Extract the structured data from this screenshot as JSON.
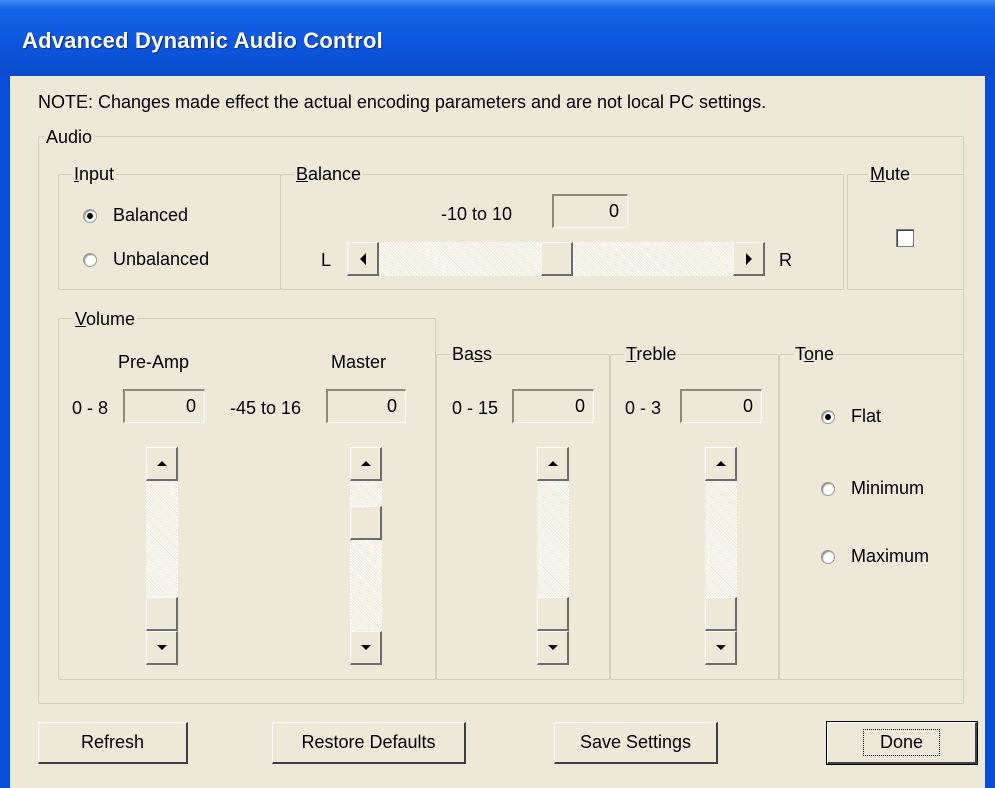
{
  "window": {
    "title": "Advanced Dynamic Audio Control"
  },
  "note": "NOTE: Changes made effect the actual encoding parameters and are not local PC settings.",
  "audio": {
    "label": "Audio",
    "input": {
      "label_accel": "I",
      "label_rest": "nput",
      "options": [
        {
          "label": "Balanced",
          "selected": true
        },
        {
          "label": "Unbalanced",
          "selected": false
        }
      ]
    },
    "balance": {
      "label_accel": "B",
      "label_rest": "alance",
      "range": "-10 to 10",
      "value": "0",
      "left_label": "L",
      "right_label": "R",
      "slider_level": 0.5
    },
    "mute": {
      "label_accel": "M",
      "label_rest": "ute",
      "checked": false
    },
    "volume": {
      "label_accel": "V",
      "label_rest": "olume",
      "preamp": {
        "title": "Pre-Amp",
        "range": "0 - 8",
        "value": "0"
      },
      "master": {
        "title": "Master",
        "range": "-45 to 16",
        "value": "0"
      }
    },
    "bass": {
      "label_pre": "Ba",
      "label_accel": "s",
      "label_rest": "s",
      "range": "0 - 15",
      "value": "0"
    },
    "treble": {
      "label_accel": "T",
      "label_rest": "reble",
      "range": "0 - 3",
      "value": "0"
    },
    "tone": {
      "label_pre": "T",
      "label_accel": "o",
      "label_rest": "ne",
      "options": [
        {
          "label": "Flat",
          "selected": true
        },
        {
          "label": "Minimum",
          "selected": false
        },
        {
          "label": "Maximum",
          "selected": false
        }
      ]
    }
  },
  "buttons": {
    "refresh": "Refresh",
    "restore_defaults": "Restore Defaults",
    "save_settings": "Save Settings",
    "done": "Done"
  }
}
